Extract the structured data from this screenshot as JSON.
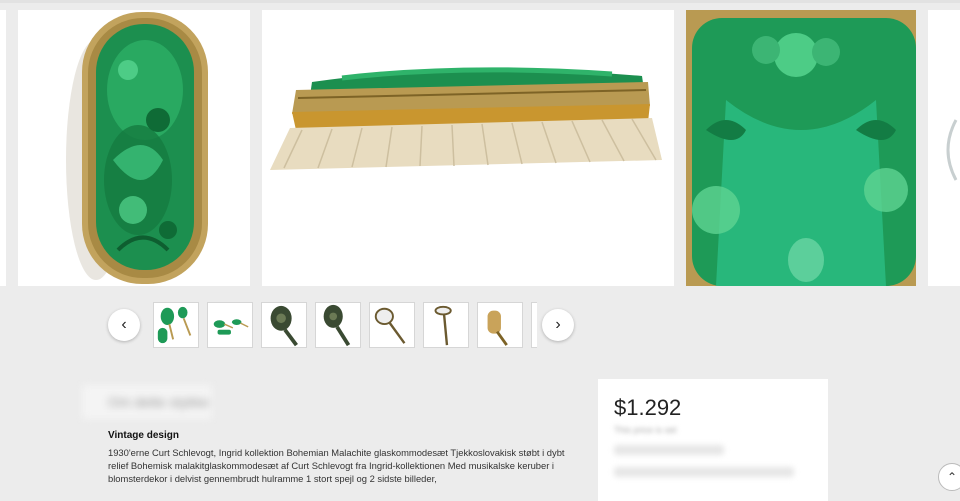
{
  "gallery": {
    "slides": [
      {
        "name": "brush-top-view"
      },
      {
        "name": "brush-side-view"
      },
      {
        "name": "mirror-detail"
      }
    ],
    "prev_icon": "‹",
    "next_icon": "›",
    "thumbnails": [
      {
        "name": "set-overview"
      },
      {
        "name": "set-flat"
      },
      {
        "name": "mirror-back"
      },
      {
        "name": "mirror-back-angle"
      },
      {
        "name": "mirror-front"
      },
      {
        "name": "mirror-glass"
      },
      {
        "name": "brush"
      }
    ]
  },
  "about": {
    "heading": "Om dette stykke",
    "subheading": "Vintage design",
    "description": "1930'erne Curt Schlevogt, Ingrid kollektion Bohemian Malachite glaskommodesæt Tjekkoslovakisk støbt i dybt relief Bohemisk malakitglaskommodesæt af Curt Schlevogt fra Ingrid-kollektionen Med musikalske keruber i blomsterdekor i delvist gennembrudt hulramme 1 stort spejl og 2 sidste billeder,"
  },
  "price_card": {
    "price": "$1.292",
    "note": "This price is set"
  },
  "colors": {
    "malachite": "#1e9a57",
    "brass": "#b99a52",
    "bristle": "#e8dcc0",
    "background": "#ececec"
  }
}
